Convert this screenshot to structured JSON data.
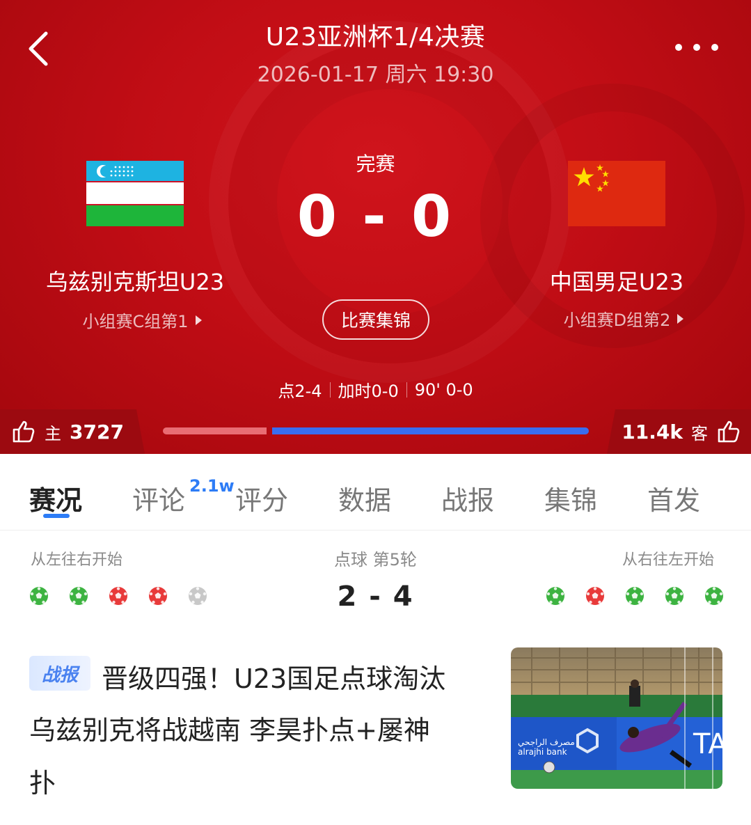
{
  "header": {
    "title": "U23亚洲杯1/4决赛",
    "datetime": "2026-01-17 周六 19:30",
    "status": "完赛",
    "score": "0 - 0",
    "highlights_label": "比赛集锦",
    "score_detail": [
      "点2-4",
      "加时0-0",
      "90' 0-0"
    ],
    "back_icon": "chevron-left-icon",
    "more_icon": "more-dots-icon",
    "accent_color": "#c10d15"
  },
  "home": {
    "name": "乌兹别克斯坦U23",
    "group": "小组赛C组第1",
    "flag_icon": "uzbekistan-flag-icon"
  },
  "away": {
    "name": "中国男足U23",
    "group": "小组赛D组第2",
    "flag_icon": "china-flag-icon"
  },
  "votes": {
    "home_label": "主",
    "home_count": "3727",
    "away_label": "客",
    "away_count": "11.4k",
    "home_share": 0.246,
    "home_color": "#e96d74",
    "away_color": "#3a6df0"
  },
  "tabs": {
    "items": [
      "赛况",
      "评论",
      "评分",
      "数据",
      "战报",
      "集锦",
      "首发"
    ],
    "active_index": 0,
    "comment_badge": "2.1w",
    "accent_color": "#2d7cf6"
  },
  "penalty": {
    "left_label": "从左往右开始",
    "round_label": "点球 第5轮",
    "right_label": "从右往左开始",
    "score": "2 - 4",
    "home_kicks": [
      "scored",
      "scored",
      "missed",
      "missed",
      "pending"
    ],
    "away_kicks": [
      "scored",
      "missed",
      "scored",
      "scored",
      "scored"
    ],
    "scored_color": "#3db341",
    "missed_color": "#e83a3a",
    "pending_color": "#c8c8c8"
  },
  "news": {
    "tag": "战报",
    "line1": "晋级四强！U23国足点球淘汰",
    "line2": "乌兹别克将战越南 李昊扑点+屡神",
    "line3": "扑",
    "image_icon": "goalkeeper-photo",
    "image_text_1": "مصرف الراجحي",
    "image_text_2": "alrajhi bank",
    "image_text_3": "TA"
  }
}
